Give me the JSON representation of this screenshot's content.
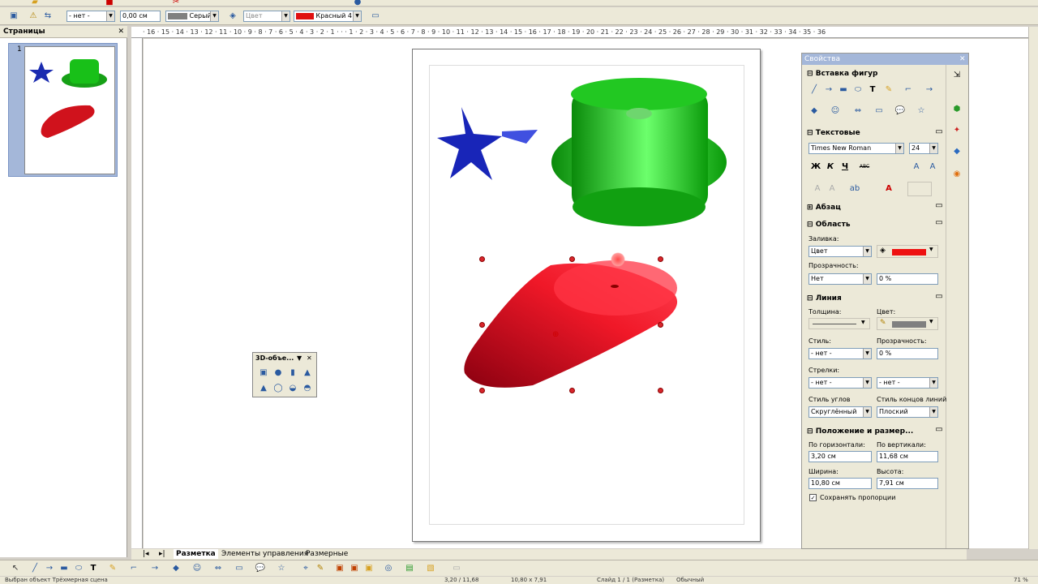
{
  "panel": {
    "pages_title": "Страницы",
    "page_number": "1"
  },
  "line_toolbar": {
    "line_style": "- нет -",
    "line_width": "0,00 см",
    "line_color": "Серый",
    "area_style": "Цвет",
    "area_color": "Красный 4"
  },
  "ruler": {
    "labels": "· 16 · 15 · 14 · 13 · 12 · 11 · 10 · 9 · 8 · 7 · 6 · 5 · 4 · 3 · 2 · 1 · · · 1 · 2 · 3 · 4 · 5 · 6 · 7 · 8 · 9 · 10 · 11 · 12 · 13 · 14 · 15 · 16 · 17 · 18 · 19 · 20 · 21 · 22 · 23 · 24 · 25 · 26 · 27 · 28 · 29 · 30 · 31 · 32 · 33 · 34 · 35 · 36"
  },
  "tb3d": {
    "title": "3D-объе..."
  },
  "sidebar": {
    "title": "Свойства",
    "insert_shapes": "Вставка фигур",
    "text": "Текстовые",
    "font_name": "Times New Roman",
    "font_size": "24",
    "bold": "Ж",
    "italic": "К",
    "underline": "Ч",
    "strike": "ABC",
    "paragraph": "Абзац",
    "area": "Область",
    "fill_label": "Заливка:",
    "fill_value": "Цвет",
    "transparency_label": "Прозрачность:",
    "transparency_value": "Нет",
    "transparency_pct": "0 %",
    "line": "Линия",
    "thickness_label": "Толщина:",
    "color_label": "Цвет:",
    "style_label": "Стиль:",
    "style_value": "- нет -",
    "line_transparency_label": "Прозрачность:",
    "line_transparency_value": "0 %",
    "arrows_label": "Стрелки:",
    "arrow_start": "- нет -",
    "arrow_end": "- нет -",
    "corner_label": "Стиль углов",
    "corner_value": "Скруглённый",
    "cap_label": "Стиль концов линий",
    "cap_value": "Плоский",
    "position_size": "Положение и размер...",
    "horizontal_label": "По горизонтали:",
    "horizontal_value": "3,20 см",
    "vertical_label": "По вертикали:",
    "vertical_value": "11,68 см",
    "width_label": "Ширина:",
    "width_value": "10,80 см",
    "height_label": "Высота:",
    "height_value": "7,91 см",
    "keep_ratio": "Сохранять пропорции"
  },
  "tabs": {
    "layout": "Разметка",
    "controls": "Элементы управления",
    "dimension": "Размерные"
  },
  "status": {
    "selection": "Выбран объект Трёхмерная сцена",
    "position": "3,20 / 11,68",
    "size": "10,80 x 7,91",
    "slide": "Слайд 1 / 1 (Разметка)",
    "layout": "Обычный",
    "zoom": "71 %"
  },
  "colors": {
    "accent_red": "#e01010",
    "fill_red": "#ee1111"
  }
}
